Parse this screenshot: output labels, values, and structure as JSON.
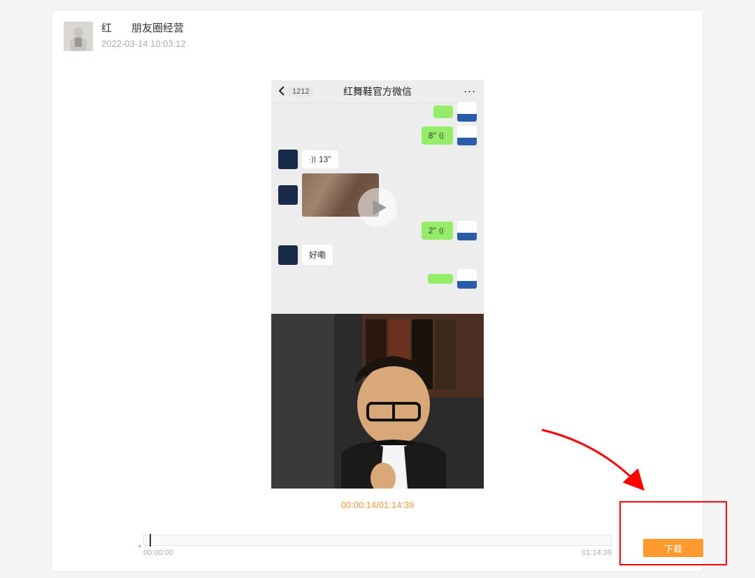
{
  "post": {
    "title_prefix": "红",
    "title_suffix": "朋友圈经营",
    "timestamp": "2022-03-14 10:03:12"
  },
  "chat": {
    "back_count": "1212",
    "title": "红舞鞋官方微信",
    "dots": "···",
    "msg_right_1": "8''",
    "msg_left_1": "13''",
    "msg_right_2": "2''",
    "msg_left_2": "好嘞"
  },
  "video": {
    "current": "00:00:14",
    "sep": "/",
    "total": "01:14:39"
  },
  "timeline": {
    "start": "00:00:00",
    "end": "01:14:39"
  },
  "download_label": "下载"
}
